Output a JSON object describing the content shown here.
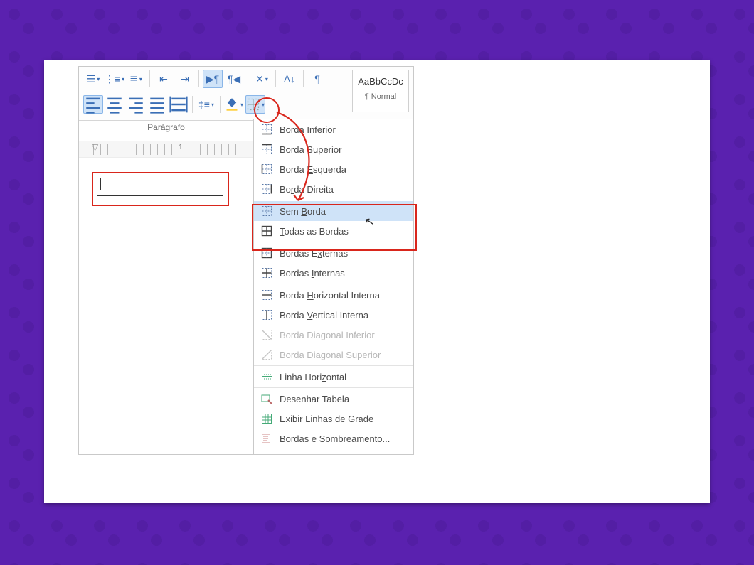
{
  "ribbon": {
    "group_label": "Parágrafo",
    "style_preview": "AaBbCcDc",
    "style_name": "¶ Normal",
    "ruler_marks": [
      "1"
    ]
  },
  "menu": {
    "items": [
      {
        "id": "borda-inferior",
        "label": "Borda Inferior",
        "u": "I",
        "icon": "b-bottom"
      },
      {
        "id": "borda-superior",
        "label": "Borda Superior",
        "u": "u",
        "icon": "b-top"
      },
      {
        "id": "borda-esquerda",
        "label": "Borda Esquerda",
        "u": "E",
        "icon": "b-left"
      },
      {
        "id": "borda-direita",
        "label": "Borda Direita",
        "u": "r",
        "icon": "b-right"
      },
      {
        "sep": true
      },
      {
        "id": "sem-borda",
        "label": "Sem Borda",
        "u": "B",
        "icon": "b-none",
        "selected": true
      },
      {
        "id": "todas-bordas",
        "label": "Todas as Bordas",
        "u": "T",
        "icon": "b-all"
      },
      {
        "sep": true
      },
      {
        "id": "bordas-externas",
        "label": "Bordas Externas",
        "u": "x",
        "icon": "b-out"
      },
      {
        "id": "bordas-internas",
        "label": "Bordas Internas",
        "u": "I",
        "icon": "b-in"
      },
      {
        "sep": true
      },
      {
        "id": "borda-horizontal-interna",
        "label": "Borda Horizontal Interna",
        "u": "H",
        "icon": "b-hmid"
      },
      {
        "id": "borda-vertical-interna",
        "label": "Borda Vertical Interna",
        "u": "V",
        "icon": "b-vmid"
      },
      {
        "id": "borda-diagonal-inferior",
        "label": "Borda Diagonal Inferior",
        "icon": "b-diag1",
        "disabled": true
      },
      {
        "id": "borda-diagonal-superior",
        "label": "Borda Diagonal Superior",
        "icon": "b-diag2",
        "disabled": true
      },
      {
        "sep": true
      },
      {
        "id": "linha-horizontal",
        "label": "Linha Horizontal",
        "u": "z",
        "icon": "hline"
      },
      {
        "sep": true
      },
      {
        "id": "desenhar-tabela",
        "label": "Desenhar Tabela",
        "icon": "draw"
      },
      {
        "id": "exibir-linhas-grade",
        "label": "Exibir Linhas de Grade",
        "icon": "grid"
      },
      {
        "id": "bordas-sombreamento",
        "label": "Bordas e Sombreamento...",
        "icon": "dialog"
      }
    ]
  },
  "colors": {
    "accent": "#3b6fb6",
    "hi": "#d9261c",
    "sel": "#cfe3f8"
  }
}
